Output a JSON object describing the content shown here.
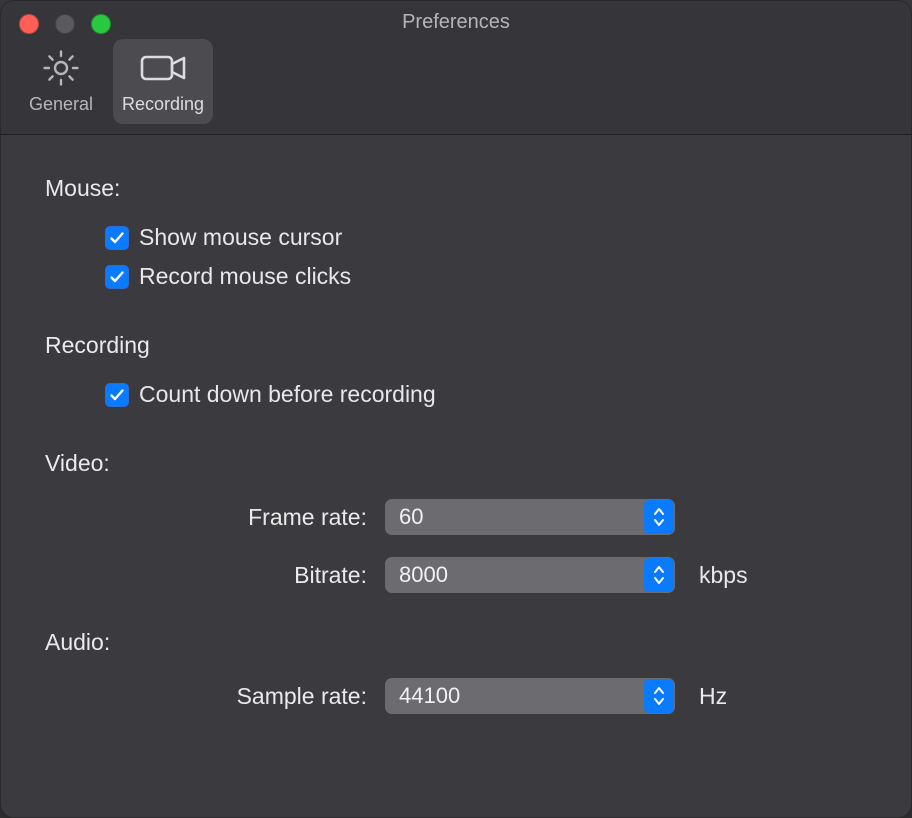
{
  "window": {
    "title": "Preferences"
  },
  "tabs": {
    "general": {
      "label": "General"
    },
    "recording": {
      "label": "Recording"
    }
  },
  "sections": {
    "mouse": {
      "title": "Mouse:",
      "show_cursor": {
        "checked": true,
        "label": "Show mouse cursor"
      },
      "record_clicks": {
        "checked": true,
        "label": "Record mouse clicks"
      }
    },
    "recording": {
      "title": "Recording",
      "countdown": {
        "checked": true,
        "label": "Count down before recording"
      }
    },
    "video": {
      "title": "Video:",
      "frame_rate": {
        "label": "Frame rate:",
        "value": "60"
      },
      "bitrate": {
        "label": "Bitrate:",
        "value": "8000",
        "unit": "kbps"
      }
    },
    "audio": {
      "title": "Audio:",
      "sample_rate": {
        "label": "Sample rate:",
        "value": "44100",
        "unit": "Hz"
      }
    }
  },
  "colors": {
    "accent": "#0a7aff"
  }
}
